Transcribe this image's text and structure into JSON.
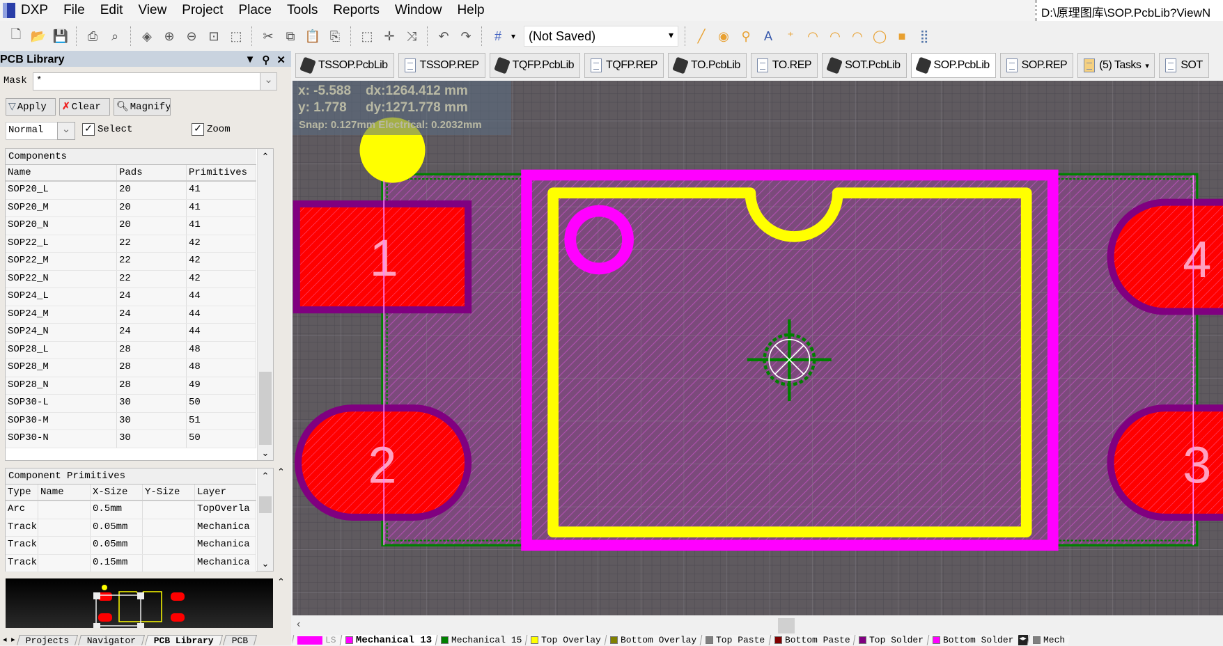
{
  "app": {
    "menu": [
      "DXP",
      "File",
      "Edit",
      "View",
      "Project",
      "Place",
      "Tools",
      "Reports",
      "Window",
      "Help"
    ],
    "title_path": "D:\\原理图库\\SOP.PcbLib?ViewN"
  },
  "toolbar": {
    "icons": [
      "new-icon",
      "open-icon",
      "save-icon",
      "print-icon",
      "print-preview-icon",
      "3d-view-icon",
      "zoom-in-icon",
      "zoom-out-icon",
      "zoom-fit-icon",
      "zoom-selected-icon",
      "cut-icon",
      "copy-icon",
      "paste-icon",
      "rubber-stamp-icon",
      "select-area-icon",
      "move-icon",
      "deselect-icon",
      "undo-icon",
      "redo-icon",
      "grid-icon"
    ],
    "view_config": "(Not Saved)",
    "place_icons": [
      "place-line-icon",
      "place-pad-icon",
      "place-via-icon",
      "place-string-icon",
      "place-coordinate-icon",
      "arc-center-icon",
      "arc-edge-icon",
      "arc-any-icon",
      "full-circle-icon",
      "fill-icon",
      "array-paste-icon"
    ]
  },
  "panel": {
    "title": "PCB Library",
    "mask_label": "Mask",
    "mask_value": "*",
    "apply": "Apply",
    "clear": "Clear",
    "magnify": "Magnify",
    "mode": "Normal",
    "select_label": "Select",
    "select_checked": true,
    "zoom_label": "Zoom",
    "zoom_checked": true,
    "components": {
      "title": "Components",
      "columns": [
        "Name",
        "Pads",
        "Primitives"
      ],
      "rows": [
        [
          "SOP20_L",
          "20",
          "41"
        ],
        [
          "SOP20_M",
          "20",
          "41"
        ],
        [
          "SOP20_N",
          "20",
          "41"
        ],
        [
          "SOP22_L",
          "22",
          "42"
        ],
        [
          "SOP22_M",
          "22",
          "42"
        ],
        [
          "SOP22_N",
          "22",
          "42"
        ],
        [
          "SOP24_L",
          "24",
          "44"
        ],
        [
          "SOP24_M",
          "24",
          "44"
        ],
        [
          "SOP24_N",
          "24",
          "44"
        ],
        [
          "SOP28_L",
          "28",
          "48"
        ],
        [
          "SOP28_M",
          "28",
          "48"
        ],
        [
          "SOP28_N",
          "28",
          "49"
        ],
        [
          "SOP30-L",
          "30",
          "50"
        ],
        [
          "SOP30-M",
          "30",
          "51"
        ],
        [
          "SOP30-N",
          "30",
          "50"
        ]
      ]
    },
    "primitives": {
      "title": "Component Primitives",
      "columns": [
        "Type",
        "Name",
        "X-Size",
        "Y-Size",
        "Layer"
      ],
      "rows": [
        [
          "Arc",
          "",
          "0.5mm",
          "",
          "TopOverla"
        ],
        [
          "Track",
          "",
          "0.05mm",
          "",
          "Mechanica"
        ],
        [
          "Track",
          "",
          "0.05mm",
          "",
          "Mechanica"
        ],
        [
          "Track",
          "",
          "0.15mm",
          "",
          "Mechanica"
        ]
      ]
    },
    "bottom_tabs": [
      "Projects",
      "Navigator",
      "PCB Library",
      "PCB"
    ],
    "active_bottom_tab": "PCB Library"
  },
  "doc_tabs": [
    {
      "label": "TSSOP.PcbLib",
      "icon": "pcblib-icon"
    },
    {
      "label": "TSSOP.REP",
      "icon": "document-icon"
    },
    {
      "label": "TQFP.PcbLib",
      "icon": "pcblib-icon"
    },
    {
      "label": "TQFP.REP",
      "icon": "document-icon"
    },
    {
      "label": "TO.PcbLib",
      "icon": "pcblib-icon"
    },
    {
      "label": "TO.REP",
      "icon": "document-icon"
    },
    {
      "label": "SOT.PcbLib",
      "icon": "pcblib-icon"
    },
    {
      "label": "SOP.PcbLib",
      "icon": "pcblib-icon",
      "active": true
    },
    {
      "label": "SOP.REP",
      "icon": "document-icon"
    },
    {
      "label": "(5) Tasks",
      "icon": "tasks-icon"
    },
    {
      "label": "SOT",
      "icon": "document-icon"
    }
  ],
  "readout": {
    "x": "x: -5.588",
    "dx": "dx:1264.412 mm",
    "y": "y:  1.778",
    "dy": "dy:1271.778 mm",
    "snap": "Snap: 0.127mm Electrical: 0.2032mm"
  },
  "pads": [
    "1",
    "2",
    "3",
    "4"
  ],
  "layers": {
    "current_swatch": "LS",
    "tabs": [
      {
        "label": "Mechanical 13",
        "color": "#ff00ff",
        "active": true
      },
      {
        "label": "Mechanical 15",
        "color": "#008000"
      },
      {
        "label": "Top Overlay",
        "color": "#ffff00"
      },
      {
        "label": "Bottom Overlay",
        "color": "#808000"
      },
      {
        "label": "Top Paste",
        "color": "#808080"
      },
      {
        "label": "Bottom Paste",
        "color": "#800000"
      },
      {
        "label": "Top Solder",
        "color": "#800080"
      },
      {
        "label": "Bottom Solder",
        "color": "#ff00ff"
      },
      {
        "label": "Mech",
        "color": "#808080"
      }
    ]
  },
  "colors": {
    "pad": "#ff0000",
    "solder": "#800080",
    "overlay": "#ffff00",
    "mech13": "#ff00ff",
    "mech15": "#008000",
    "canvas": "#5f5a5f"
  }
}
